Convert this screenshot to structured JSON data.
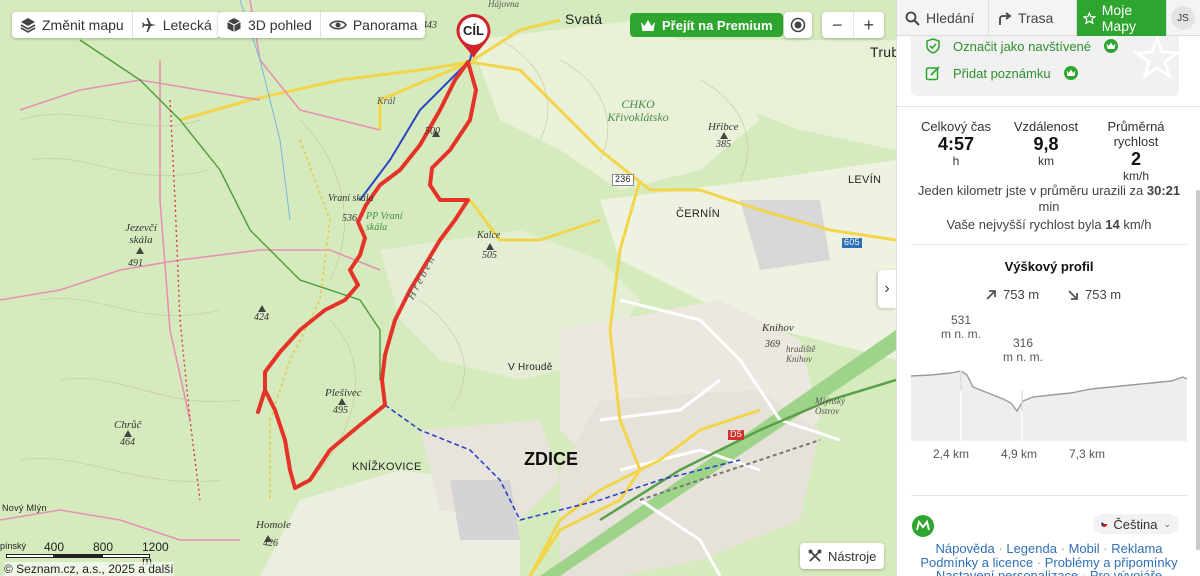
{
  "toolbar": {
    "change_map": "Změnit mapu",
    "aerial": "Letecká",
    "view3d": "3D pohled",
    "panorama": "Panorama",
    "premium": "Přejít na Premium",
    "zoom_out": "−",
    "zoom_in": "+"
  },
  "map": {
    "destination_pin": "CÍL",
    "labels": {
      "svata": "Svatá",
      "trub": "Trub",
      "kral": "Král",
      "hajovna": "Hájovna",
      "p500": "500",
      "p443": "443",
      "chko": "CHKO Křivoklátsko",
      "hribce": "Hřibce",
      "p385": "385",
      "vrani_skala": "Vraní skála",
      "p536": "536",
      "pp_vrani": "PP Vraní skála",
      "jezevci": "Jezevčí skála",
      "p491": "491",
      "kalce": "Kalce",
      "p505": "505",
      "cernin": "ČERNÍN",
      "levin": "LEVÍN",
      "road236": "236",
      "road605": "605",
      "hreben": "H ř e b e n",
      "p424": "424",
      "knihov": "Knihov",
      "p369": "369",
      "hradiste": "hradiště Knihov",
      "v_hroude": "V Hroudě",
      "plesivec": "Plešivec",
      "p495": "495",
      "chrudic": "Chrůč",
      "p464": "464",
      "mlynsky": "Mlýnský Ostrov",
      "zdice": "ZDICE",
      "knizkovice": "KNÍŽKOVICE",
      "homole": "Homole",
      "p426": "426",
      "novy_mlyn": "Nový Mlýn",
      "d5": "D5"
    },
    "scale": [
      "400",
      "800",
      "1200 m"
    ],
    "scale_left": "pínský",
    "copyright": "© Seznam.cz, a.s., 2025 a další",
    "tools": "Nástroje"
  },
  "panel": {
    "tabs": [
      "Hledání",
      "Trasa",
      "Moje Mapy"
    ],
    "avatar": "JS",
    "actions": {
      "visited": "Označit jako navštívené",
      "note": "Přidat poznámku"
    },
    "stats": {
      "time_label": "Celkový čas",
      "time_value": "4:57",
      "time_unit": "h",
      "distance_label": "Vzdálenost",
      "distance_value": "9,8",
      "distance_unit": "km",
      "speed_label": "Průměrná rychlost",
      "speed_value": "2",
      "speed_unit": "km/h"
    },
    "pace_text": "Jeden kilometr jste v průměru urazili za",
    "pace_value": "30:21",
    "pace_unit": "min",
    "max_speed_text": "Vaše nejvyšší rychlost byla",
    "max_speed_value": "14",
    "max_speed_unit": "km/h",
    "profile": {
      "title": "Výškový profil",
      "ascent": "753 m",
      "descent": "753 m",
      "max_value": "531",
      "max_unit": "m n. m.",
      "min_value": "316",
      "min_unit": "m n. m.",
      "x_ticks": [
        "2,4 km",
        "4,9 km",
        "7,3 km"
      ]
    },
    "footer": {
      "language": "Čeština",
      "links_row1": [
        "Nápověda",
        "Legenda",
        "Mobil",
        "Reklama"
      ],
      "links_row2": [
        "Podmínky a licence",
        "Problémy a připomínky"
      ],
      "links_row3": [
        "Nastavení personalizace",
        "Pro vývojáře"
      ]
    }
  },
  "colors": {
    "accent": "#2ea52e",
    "route": "#e5332a",
    "link": "#2f6fb5"
  }
}
